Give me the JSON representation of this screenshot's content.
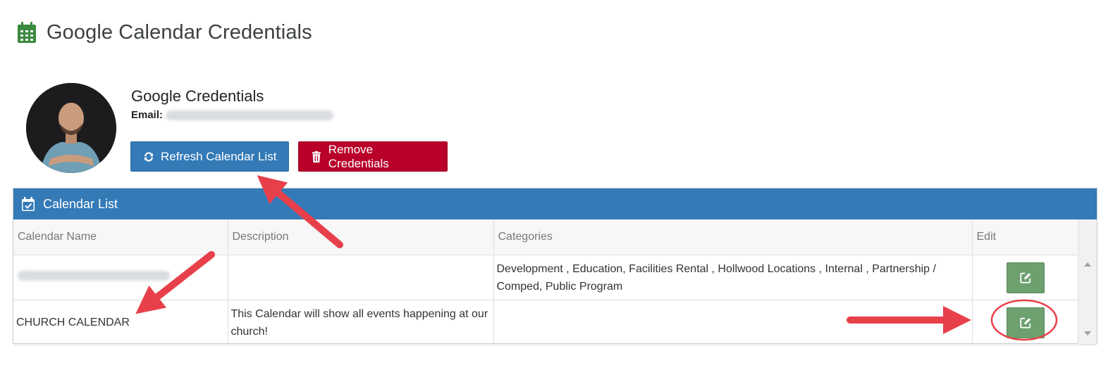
{
  "page": {
    "title": "Google Calendar Credentials",
    "title_icon": "calendar-icon",
    "accent_green": "#3a8a3f"
  },
  "credentials": {
    "heading": "Google Credentials",
    "email_label": "Email:",
    "avatar": "user-photo",
    "refresh_button": "Refresh Calendar List",
    "refresh_icon": "refresh-icon",
    "remove_button": "Remove Credentials",
    "remove_icon": "trash-icon",
    "refresh_color": "#337ab7",
    "remove_color": "#b8002a"
  },
  "calendar_list": {
    "panel_title": "Calendar List",
    "panel_icon": "calendar-check-icon",
    "columns": [
      "Calendar Name",
      "Description",
      "Categories",
      "Edit"
    ],
    "rows": [
      {
        "name": "",
        "description": "",
        "categories": "Development , Education, Facilities Rental , Hollwood Locations , Internal , Partnership / Comped, Public Program"
      },
      {
        "name": "CHURCH CALENDAR",
        "description": "This Calendar will show all events happening at our church!",
        "categories": ""
      }
    ],
    "edit_icon": "edit-icon",
    "edit_color": "#6da06f"
  },
  "annotations": {
    "arrow_color": "#e8404a",
    "highlight": "edit-button-circle"
  }
}
